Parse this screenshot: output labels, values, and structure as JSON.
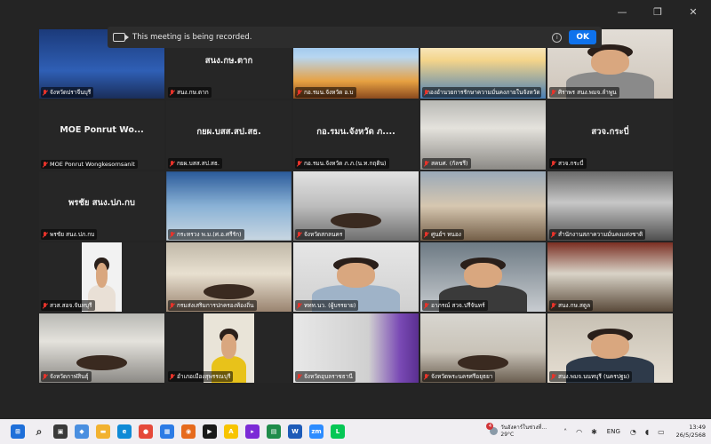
{
  "window": {
    "controls": {
      "minimize": "—",
      "restore": "❐",
      "close": "✕"
    }
  },
  "banner": {
    "text": "This meeting is being recorded.",
    "info": "i",
    "ok_label": "OK"
  },
  "tiles": [
    {
      "label": "จังหวัดปราจีนบุรี",
      "scene": "blue",
      "muted": true
    },
    {
      "big": "สนง.กษ.ตาก",
      "label": "สนง.กษ.ตาก",
      "muted": true
    },
    {
      "label": "กอ.รมน.จังหวัด อ.บ",
      "scene": "poster",
      "muted": true
    },
    {
      "label": "กองอำนวยการรักษาความมั่นคงภายในจังหวัด",
      "scene": "poster2",
      "muted": true
    },
    {
      "label": "ศิราพร สนง.พมจ.ลำพูน",
      "scene": "person-f",
      "muted": true
    },
    {
      "big": "MOE Ponrut Wo...",
      "label": "MOE Ponrut Wongkesornsanit",
      "muted": true
    },
    {
      "big": "กยผ.บสส.สป.สธ.",
      "label": "กยผ.บสส.สป.สธ.",
      "muted": true
    },
    {
      "big": "กอ.รมน.จังหวัด ภ....",
      "label": "กอ.รมน.จังหวัด ภ.ภ.(น.ท.กฤติน)",
      "muted": true
    },
    {
      "label": "สคบศ. (กัลชรี)",
      "scene": "office",
      "muted": true
    },
    {
      "big": "สวจ.กระบี่",
      "label": "สวจ.กระบี่",
      "muted": true
    },
    {
      "big": "พรชัย สนง.ปภ.กบ",
      "label": "พรชัย สนง.ปภ.กบ",
      "muted": true
    },
    {
      "label": "กระทรวง พ.ม.(ศ.อ.ศรีรัก)",
      "scene": "blur",
      "muted": true
    },
    {
      "label": "จังหวัดสกลนคร",
      "scene": "hall",
      "muted": true
    },
    {
      "label": "ศูนย์ฯ หนอง",
      "scene": "room2",
      "muted": true
    },
    {
      "label": "สำนักงานสภาความมั่นคงแห่งชาติ",
      "scene": "dark",
      "muted": true
    },
    {
      "label": "สวส.สอจ.จันทบุรี",
      "scene": "person-f2",
      "muted": true
    },
    {
      "label": "กรมส่งเสริมการปกครองท้องถิ่น",
      "scene": "meet",
      "muted": true
    },
    {
      "label": "ททท.นว. (ผู้บรรยาย)",
      "scene": "person-m",
      "muted": true
    },
    {
      "label": "อาภรณ์ สวจ.ปรีจันทร์",
      "scene": "person-f3",
      "muted": true
    },
    {
      "label": "สนง.กษ.สตูล",
      "scene": "brown",
      "muted": true
    },
    {
      "label": "จังหวัดกาฬสินธุ์",
      "scene": "office2",
      "muted": true
    },
    {
      "label": "อำเภอเมืองสุพรรณบุรี",
      "scene": "person-y",
      "muted": true
    },
    {
      "label": "จังหวัดอุบลราชธานี",
      "scene": "purple",
      "muted": true
    },
    {
      "label": "จังหวัดพระนครศรีอยุธยา",
      "scene": "room3",
      "muted": true
    },
    {
      "label": "สนง.พมจ.นนทบุรี (นครปฐม)",
      "scene": "person-m2",
      "muted": true
    }
  ],
  "taskbar": {
    "apps": [
      {
        "name": "windows-start-icon",
        "color": "#1e6fd9",
        "glyph": "⊞"
      },
      {
        "name": "search-icon",
        "color": "#f0eef2",
        "glyph": "⌕"
      },
      {
        "name": "task-view-icon",
        "color": "#3a3a3a",
        "glyph": "▣"
      },
      {
        "name": "widgets-icon",
        "color": "#4a8fe0",
        "glyph": "◆"
      },
      {
        "name": "file-explorer-icon",
        "color": "#f2b230",
        "glyph": "▬"
      },
      {
        "name": "edge-icon",
        "color": "#0f8ad6",
        "glyph": "e"
      },
      {
        "name": "chrome-icon",
        "color": "#e5493a",
        "glyph": "●"
      },
      {
        "name": "store-icon",
        "color": "#2c7be5",
        "glyph": "▦"
      },
      {
        "name": "firefox-icon",
        "color": "#e66a1c",
        "glyph": "◉"
      },
      {
        "name": "media-icon",
        "color": "#1a1a1a",
        "glyph": "▶"
      },
      {
        "name": "app-icon",
        "color": "#f7c400",
        "glyph": "A"
      },
      {
        "name": "stream-icon",
        "color": "#7b2bd6",
        "glyph": "▸"
      },
      {
        "name": "sheets-icon",
        "color": "#1f8c4a",
        "glyph": "▤"
      },
      {
        "name": "word-icon",
        "color": "#1e5bb8",
        "glyph": "W"
      },
      {
        "name": "zoom-icon",
        "color": "#2d8cff",
        "glyph": "zm"
      },
      {
        "name": "line-icon",
        "color": "#06c755",
        "glyph": "L"
      }
    ],
    "weather": {
      "badge": "4",
      "title": "วันอังคาร์ในช่วงที่...",
      "temp": "29°C"
    },
    "tray": {
      "chevron": "˄",
      "lang": "ENG",
      "clock_time": "13:49",
      "clock_date": "26/5/2568"
    }
  }
}
